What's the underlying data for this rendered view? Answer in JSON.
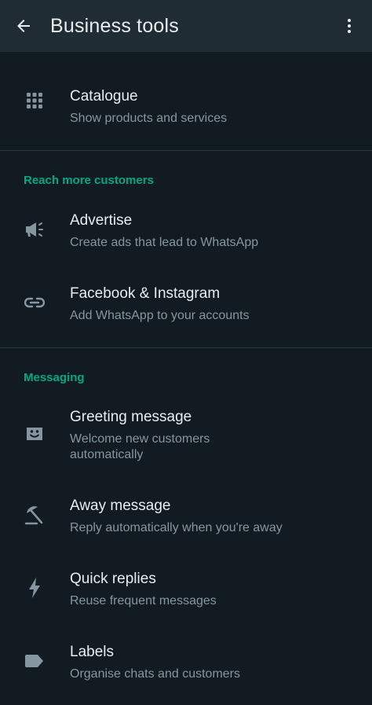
{
  "app_bar": {
    "title": "Business tools",
    "back_icon": "arrow-back-icon",
    "menu_icon": "more-vert-icon"
  },
  "colors": {
    "background": "#121b22",
    "app_bar": "#1f2c34",
    "accent": "#00a884",
    "primary_text": "#e9edef",
    "secondary_text": "#8696a0",
    "divider": "#2a3942"
  },
  "items": {
    "catalogue": {
      "label": "Catalogue",
      "sub": "Show products and services",
      "icon": "grid-icon"
    },
    "advertise": {
      "label": "Advertise",
      "sub": "Create ads that lead to WhatsApp",
      "icon": "megaphone-icon"
    },
    "facebook_instagram": {
      "label": "Facebook & Instagram",
      "sub": "Add WhatsApp to your accounts",
      "icon": "link-icon"
    },
    "greeting_message": {
      "label": "Greeting message",
      "sub": "Welcome new customers automatically",
      "icon": "greeting-face-icon"
    },
    "away_message": {
      "label": "Away message",
      "sub": "Reply automatically when you're away",
      "icon": "beach-umbrella-icon"
    },
    "quick_replies": {
      "label": "Quick replies",
      "sub": "Reuse frequent messages",
      "icon": "lightning-icon"
    },
    "labels": {
      "label": "Labels",
      "sub": "Organise chats and customers",
      "icon": "label-tag-icon"
    }
  },
  "sections": {
    "reach_more_customers": "Reach more customers",
    "messaging": "Messaging"
  }
}
